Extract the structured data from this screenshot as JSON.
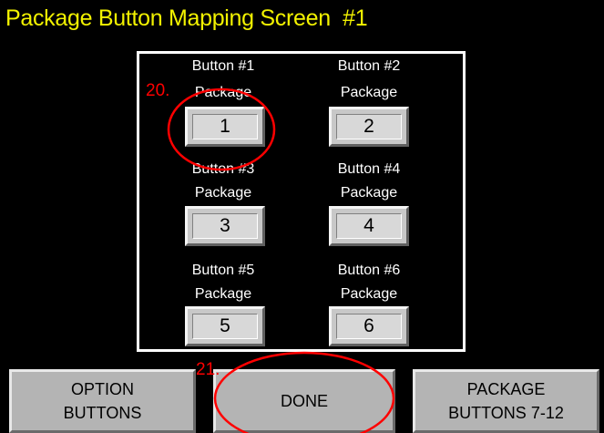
{
  "screen": {
    "title": "Package Button Mapping Screen  #1"
  },
  "buttons": [
    {
      "label": "Button #1",
      "sub": "Package",
      "value": "1"
    },
    {
      "label": "Button #2",
      "sub": "Package",
      "value": "2"
    },
    {
      "label": "Button #3",
      "sub": "Package",
      "value": "3"
    },
    {
      "label": "Button #4",
      "sub": "Package",
      "value": "4"
    },
    {
      "label": "Button #5",
      "sub": "Package",
      "value": "5"
    },
    {
      "label": "Button #6",
      "sub": "Package",
      "value": "6"
    }
  ],
  "footer": {
    "option_line1": "OPTION",
    "option_line2": "BUTTONS",
    "done": "DONE",
    "package_line1": "PACKAGE",
    "package_line2": "BUTTONS 7-12"
  },
  "annotations": {
    "marker_20": "20.",
    "marker_21": "21.",
    "color": "#ff0000"
  },
  "colors": {
    "background": "#000000",
    "title": "#f2f200",
    "panel_border": "#ffffff"
  }
}
